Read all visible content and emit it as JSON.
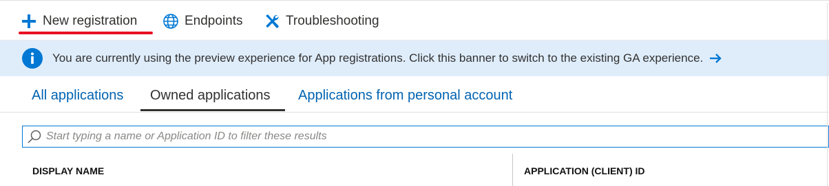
{
  "toolbar": {
    "new_registration": "New registration",
    "endpoints": "Endpoints",
    "troubleshooting": "Troubleshooting"
  },
  "banner": {
    "message": "You are currently using the preview experience for App registrations. Click this banner to switch to the existing GA experience."
  },
  "tabs": [
    {
      "label": "All applications",
      "selected": false
    },
    {
      "label": "Owned applications",
      "selected": true
    },
    {
      "label": "Applications from personal account",
      "selected": false
    }
  ],
  "search": {
    "placeholder": "Start typing a name or Application ID to filter these results",
    "value": ""
  },
  "table": {
    "columns": [
      "DISPLAY NAME",
      "APPLICATION (CLIENT) ID"
    ]
  },
  "icons": {
    "new": "plus-icon",
    "endpoints": "globe-icon",
    "troubleshooting": "wrench-screwdriver-icon",
    "banner": "info-icon",
    "banner_arrow": "arrow-right-icon",
    "search": "search-icon"
  },
  "colors": {
    "accent": "#0078d4",
    "link": "#0063b1",
    "banner_bg": "#dfedfb",
    "annotation_red": "#e81123"
  }
}
